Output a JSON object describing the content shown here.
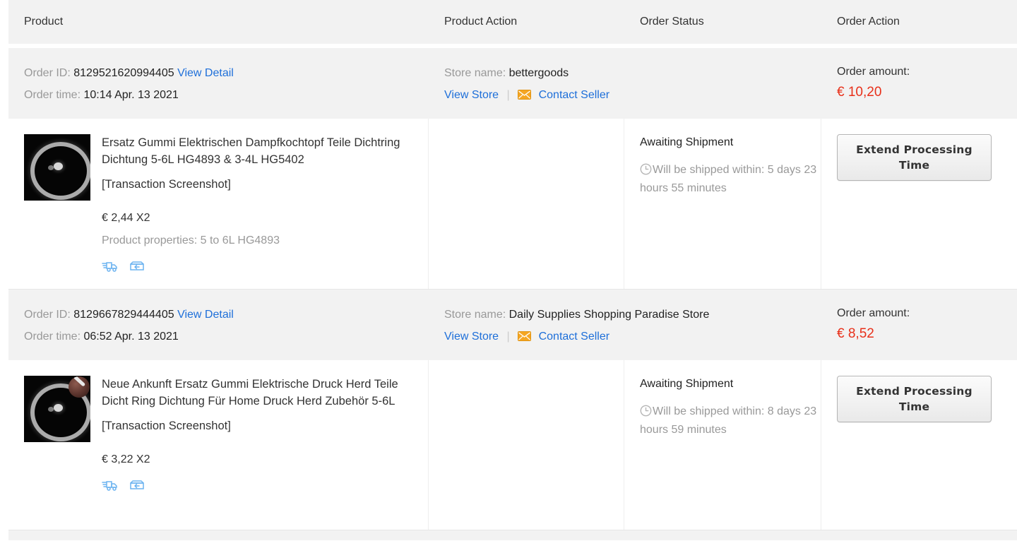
{
  "table": {
    "columns": [
      {
        "label": "Product"
      },
      {
        "label": "Product Action"
      },
      {
        "label": "Order Status"
      },
      {
        "label": "Order Action"
      }
    ],
    "labels": {
      "order_id": "Order ID:",
      "order_time": "Order time:",
      "view_detail": "View Detail",
      "store_name": "Store name:",
      "view_store": "View Store",
      "contact_seller": "Contact Seller",
      "order_amount": "Order amount:",
      "separator": "|",
      "transaction_screenshot": "[Transaction Screenshot]",
      "product_properties_prefix": "Product properties:"
    },
    "icons": {
      "envelope": "envelope-icon",
      "clock": "clock-icon",
      "shipping": "shipping-truck-icon",
      "returns": "return-box-icon"
    },
    "colors": {
      "link": "#1e6fd9",
      "amount": "#e8301a",
      "envelope": "#f5a623",
      "service_icon": "#6cb3f0",
      "header_bg": "#f2f2f2",
      "muted_text": "#999999"
    }
  },
  "orders": [
    {
      "order_id": "8129521620994405",
      "order_time": "10:14 Apr. 13 2021",
      "store_name": "bettergoods",
      "amount": "€ 10,20",
      "product": {
        "title": "Ersatz Gummi Elektrischen Dampfkochtopf Teile Dichtring Dichtung 5-6L HG4893 & 3-4L HG5402",
        "screenshot_tag": "[Transaction Screenshot]",
        "price": "€ 2,44 X2",
        "properties": "Product properties: 5 to 6L HG4893"
      },
      "status": {
        "title": "Awaiting Shipment",
        "note": "Will be shipped within: 5 days 23 hours 55 minutes"
      },
      "action_button": "Extend Processing Time"
    },
    {
      "order_id": "8129667829444405",
      "order_time": "06:52 Apr. 13 2021",
      "store_name": "Daily Supplies Shopping Paradise Store",
      "amount": "€ 8,52",
      "product": {
        "title": "Neue Ankunft Ersatz Gummi Elektrische Druck Herd Teile Dicht Ring Dichtung Für Home Druck Herd Zubehör 5-6L",
        "screenshot_tag": "[Transaction Screenshot]",
        "price": "€ 3,22 X2",
        "properties": ""
      },
      "status": {
        "title": "Awaiting Shipment",
        "note": "Will be shipped within: 8 days 23 hours 59 minutes"
      },
      "action_button": "Extend Processing Time"
    }
  ]
}
